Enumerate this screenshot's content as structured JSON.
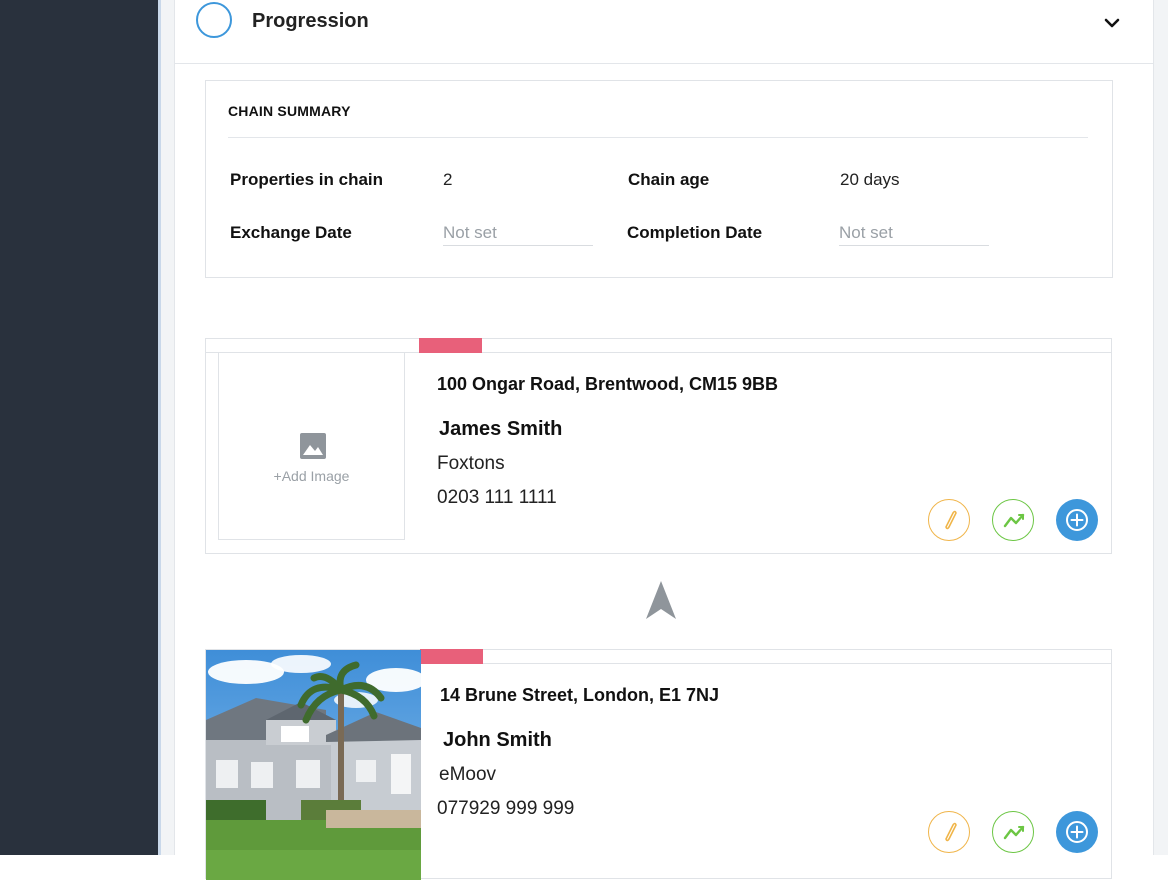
{
  "header": {
    "title": "Progression"
  },
  "chain_summary": {
    "title": "CHAIN SUMMARY",
    "properties_label": "Properties in chain",
    "properties_value": "2",
    "age_label": "Chain age",
    "age_value": "20 days",
    "exchange_label": "Exchange Date",
    "exchange_value": "Not set",
    "completion_label": "Completion Date",
    "completion_value": "Not set"
  },
  "properties": [
    {
      "address": "100 Ongar Road, Brentwood, CM15 9BB",
      "contact": "James Smith",
      "agent": "Foxtons",
      "phone": "0203 111 1111",
      "image_placeholder": "+Add Image"
    },
    {
      "address": "14 Brune Street, London, E1 7NJ",
      "contact": "John Smith",
      "agent": "eMoov",
      "phone": "077929 999 999"
    }
  ],
  "colors": {
    "sidebar": "#29313d",
    "accent_blue": "#3d97db",
    "flag_pink": "#e8607a",
    "edit_orange": "#f0b54a",
    "trend_green": "#6cc644"
  },
  "icons": [
    "chevron-down-icon",
    "image-icon",
    "pencil-icon",
    "trend-icon",
    "plus-icon",
    "arrow-up-icon"
  ]
}
